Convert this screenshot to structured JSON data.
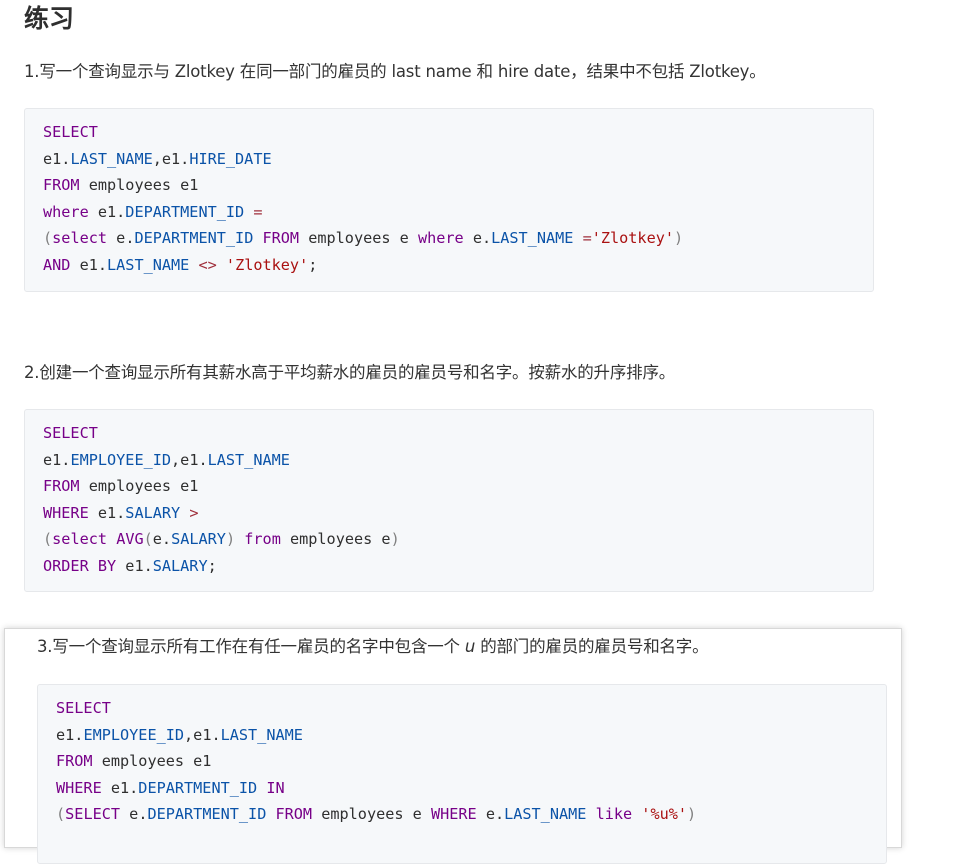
{
  "title": "练习",
  "exercises": [
    {
      "question": "1.写一个查询显示与 Zlotkey 在同一部门的雇员的 last name 和 hire date，结果中不包括 Zlotkey。",
      "code": [
        [
          [
            "kw",
            "SELECT"
          ]
        ],
        [
          [
            "t",
            "e1."
          ],
          [
            "fld",
            "LAST_NAME"
          ],
          [
            "t",
            ",e1."
          ],
          [
            "fld",
            "HIRE_DATE"
          ]
        ],
        [
          [
            "kw",
            "FROM"
          ],
          [
            "t",
            " employees e1"
          ]
        ],
        [
          [
            "kw",
            "where"
          ],
          [
            "t",
            " e1."
          ],
          [
            "fld",
            "DEPARTMENT_ID"
          ],
          [
            "t",
            " "
          ],
          [
            "op",
            "="
          ]
        ],
        [
          [
            "pn",
            "("
          ],
          [
            "kw",
            "select"
          ],
          [
            "t",
            " e."
          ],
          [
            "fld",
            "DEPARTMENT_ID"
          ],
          [
            "t",
            " "
          ],
          [
            "kw",
            "FROM"
          ],
          [
            "t",
            " employees e "
          ],
          [
            "kw",
            "where"
          ],
          [
            "t",
            " e."
          ],
          [
            "fld",
            "LAST_NAME"
          ],
          [
            "t",
            " "
          ],
          [
            "op",
            "="
          ],
          [
            "str",
            "'Zlotkey'"
          ],
          [
            "pn",
            ")"
          ]
        ],
        [
          [
            "kw",
            "AND"
          ],
          [
            "t",
            " e1."
          ],
          [
            "fld",
            "LAST_NAME"
          ],
          [
            "t",
            " "
          ],
          [
            "op",
            "<>"
          ],
          [
            "t",
            " "
          ],
          [
            "str",
            "'Zlotkey'"
          ],
          [
            "t",
            ";"
          ]
        ]
      ]
    },
    {
      "question": "2.创建一个查询显示所有其薪水高于平均薪水的雇员的雇员号和名字。按薪水的升序排序。",
      "code": [
        [
          [
            "kw",
            "SELECT"
          ]
        ],
        [
          [
            "t",
            "e1."
          ],
          [
            "fld",
            "EMPLOYEE_ID"
          ],
          [
            "t",
            ",e1."
          ],
          [
            "fld",
            "LAST_NAME"
          ]
        ],
        [
          [
            "kw",
            "FROM"
          ],
          [
            "t",
            " employees e1"
          ]
        ],
        [
          [
            "kw",
            "WHERE"
          ],
          [
            "t",
            " e1."
          ],
          [
            "fld",
            "SALARY"
          ],
          [
            "t",
            " "
          ],
          [
            "op",
            ">"
          ]
        ],
        [
          [
            "pn",
            "("
          ],
          [
            "kw",
            "select"
          ],
          [
            "t",
            " "
          ],
          [
            "kw",
            "AVG"
          ],
          [
            "pn",
            "("
          ],
          [
            "t",
            "e."
          ],
          [
            "fld",
            "SALARY"
          ],
          [
            "pn",
            ")"
          ],
          [
            "t",
            " "
          ],
          [
            "kw",
            "from"
          ],
          [
            "t",
            " employees e"
          ],
          [
            "pn",
            ")"
          ]
        ],
        [
          [
            "kw",
            "ORDER BY"
          ],
          [
            "t",
            " e1."
          ],
          [
            "fld",
            "SALARY"
          ],
          [
            "t",
            ";"
          ]
        ]
      ]
    },
    {
      "question_prefix": "3.写一个查询显示所有工作在有任一雇员的名字中包含一个 ",
      "question_emph": "u",
      "question_suffix": " 的部门的雇员的雇员号和名字。",
      "code": [
        [
          [
            "kw",
            "SELECT"
          ]
        ],
        [
          [
            "t",
            "e1."
          ],
          [
            "fld",
            "EMPLOYEE_ID"
          ],
          [
            "t",
            ",e1."
          ],
          [
            "fld",
            "LAST_NAME"
          ]
        ],
        [
          [
            "kw",
            "FROM"
          ],
          [
            "t",
            " employees e1"
          ]
        ],
        [
          [
            "kw",
            "WHERE"
          ],
          [
            "t",
            " e1."
          ],
          [
            "fld",
            "DEPARTMENT_ID"
          ],
          [
            "t",
            " "
          ],
          [
            "kw",
            "IN"
          ]
        ],
        [
          [
            "pn",
            "("
          ],
          [
            "kw",
            "SELECT"
          ],
          [
            "t",
            " e."
          ],
          [
            "fld",
            "DEPARTMENT_ID"
          ],
          [
            "t",
            " "
          ],
          [
            "kw",
            "FROM"
          ],
          [
            "t",
            " employees e "
          ],
          [
            "kw",
            "WHERE"
          ],
          [
            "t",
            " e."
          ],
          [
            "fld",
            "LAST_NAME"
          ],
          [
            "t",
            " "
          ],
          [
            "kw",
            "like"
          ],
          [
            "t",
            " "
          ],
          [
            "str",
            "'%u%'"
          ],
          [
            "pn",
            ")"
          ]
        ]
      ]
    }
  ]
}
